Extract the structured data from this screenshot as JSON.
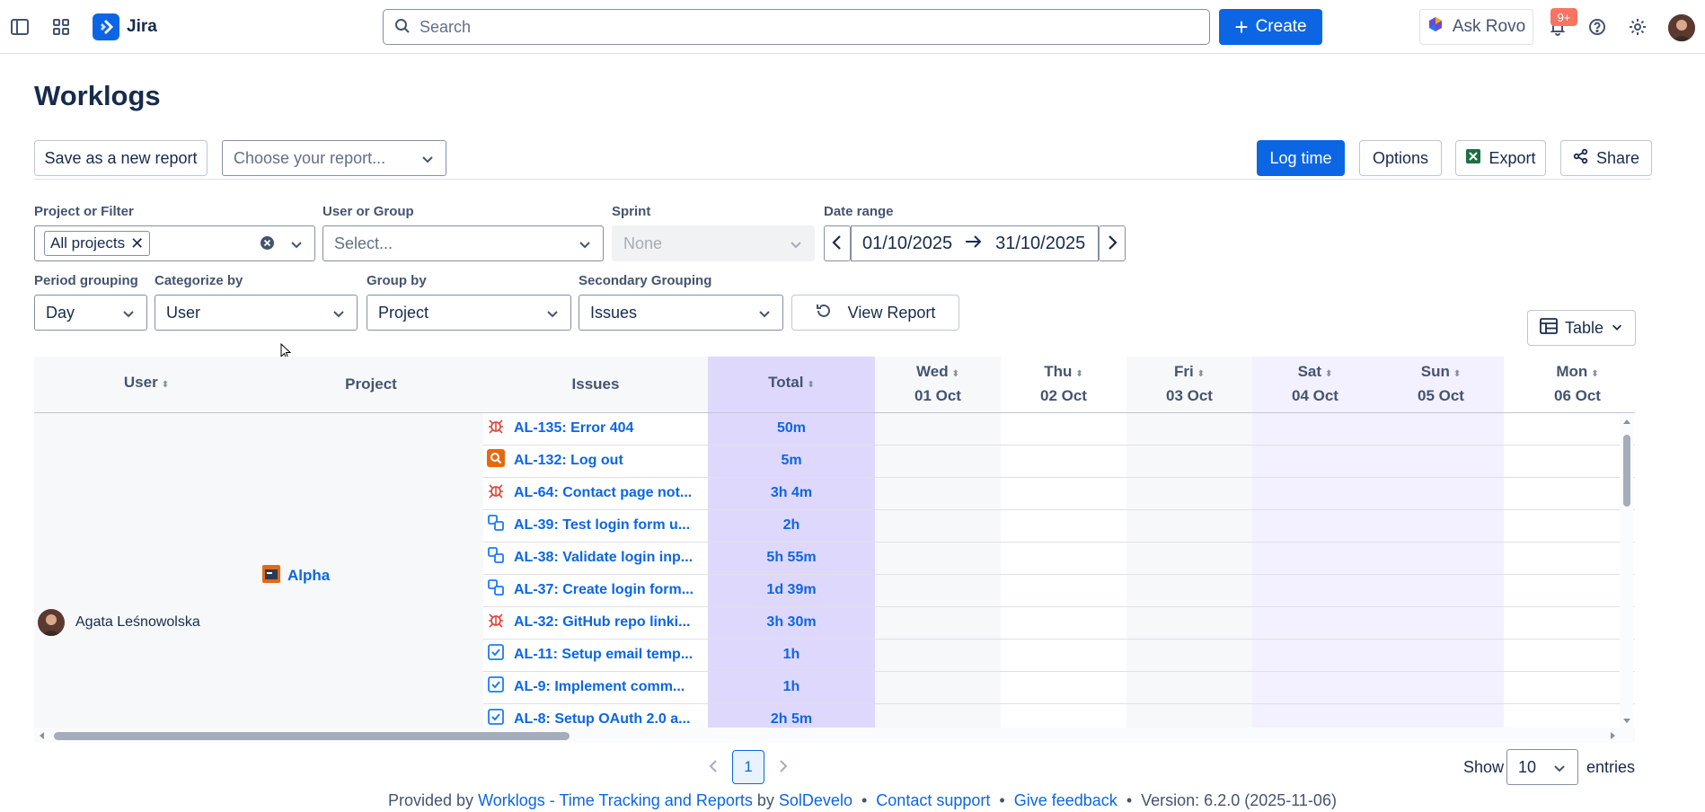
{
  "topnav": {
    "app_name": "Jira",
    "search_placeholder": "Search",
    "create_label": "Create",
    "ask_rovo_label": "Ask Rovo",
    "notification_count": "9+"
  },
  "page": {
    "title": "Worklogs",
    "save_report_label": "Save as a new report",
    "choose_report_placeholder": "Choose your report...",
    "log_time_label": "Log time",
    "options_label": "Options",
    "export_label": "Export",
    "share_label": "Share"
  },
  "filters": {
    "project_label": "Project or Filter",
    "project_chip": "All projects",
    "user_label": "User or Group",
    "user_placeholder": "Select...",
    "sprint_label": "Sprint",
    "sprint_value": "None",
    "date_label": "Date range",
    "date_from": "01/10/2025",
    "date_to": "31/10/2025",
    "period_label": "Period grouping",
    "period_value": "Day",
    "categorize_label": "Categorize by",
    "categorize_value": "User",
    "groupby_label": "Group by",
    "groupby_value": "Project",
    "secondary_label": "Secondary Grouping",
    "secondary_value": "Issues",
    "view_report_label": "View Report",
    "view_mode": "Table"
  },
  "table": {
    "headers": {
      "user": "User",
      "project": "Project",
      "issues": "Issues",
      "total": "Total"
    },
    "days": [
      {
        "dow": "Wed",
        "date": "01 Oct"
      },
      {
        "dow": "Thu",
        "date": "02 Oct"
      },
      {
        "dow": "Fri",
        "date": "03 Oct"
      },
      {
        "dow": "Sat",
        "date": "04 Oct"
      },
      {
        "dow": "Sun",
        "date": "05 Oct"
      },
      {
        "dow": "Mon",
        "date": "06 Oct"
      }
    ],
    "user_name": "Agata Leśnowolska",
    "project_name": "Alpha",
    "rows": [
      {
        "issue": "AL-135: Error 404",
        "type": "bug",
        "total": "50m"
      },
      {
        "issue": "AL-132: Log out",
        "type": "search",
        "total": "5m"
      },
      {
        "issue": "AL-64: Contact page not...",
        "type": "bug",
        "total": "3h 4m"
      },
      {
        "issue": "AL-39: Test login form u...",
        "type": "subtask",
        "total": "2h"
      },
      {
        "issue": "AL-38: Validate login inp...",
        "type": "subtask",
        "total": "5h 55m"
      },
      {
        "issue": "AL-37: Create login form...",
        "type": "subtask",
        "total": "1d 39m"
      },
      {
        "issue": "AL-32: GitHub repo linki...",
        "type": "bug",
        "total": "3h 30m"
      },
      {
        "issue": "AL-11: Setup email temp...",
        "type": "task",
        "total": "1h"
      },
      {
        "issue": "AL-9: Implement comm...",
        "type": "task",
        "total": "1h"
      },
      {
        "issue": "AL-8: Setup OAuth 2.0 a...",
        "type": "task",
        "total": "2h 5m"
      }
    ]
  },
  "pagination": {
    "current_page": "1",
    "show_label": "Show",
    "entries_value": "10",
    "entries_label": "entries"
  },
  "footer": {
    "provided_by": "Provided by",
    "app_link": "Worklogs - Time Tracking and Reports",
    "by": "by",
    "vendor_link": "SolDevelo",
    "contact_link": "Contact support",
    "feedback_link": "Give feedback",
    "version": "Version: 6.2.0 (2025-11-06)"
  },
  "colors": {
    "primary": "#0c66e4",
    "total_column": "#dfd8fd",
    "weekend_column": "#f3f0ff",
    "bug_icon": "#e2483d",
    "search_icon": "#e56910"
  }
}
